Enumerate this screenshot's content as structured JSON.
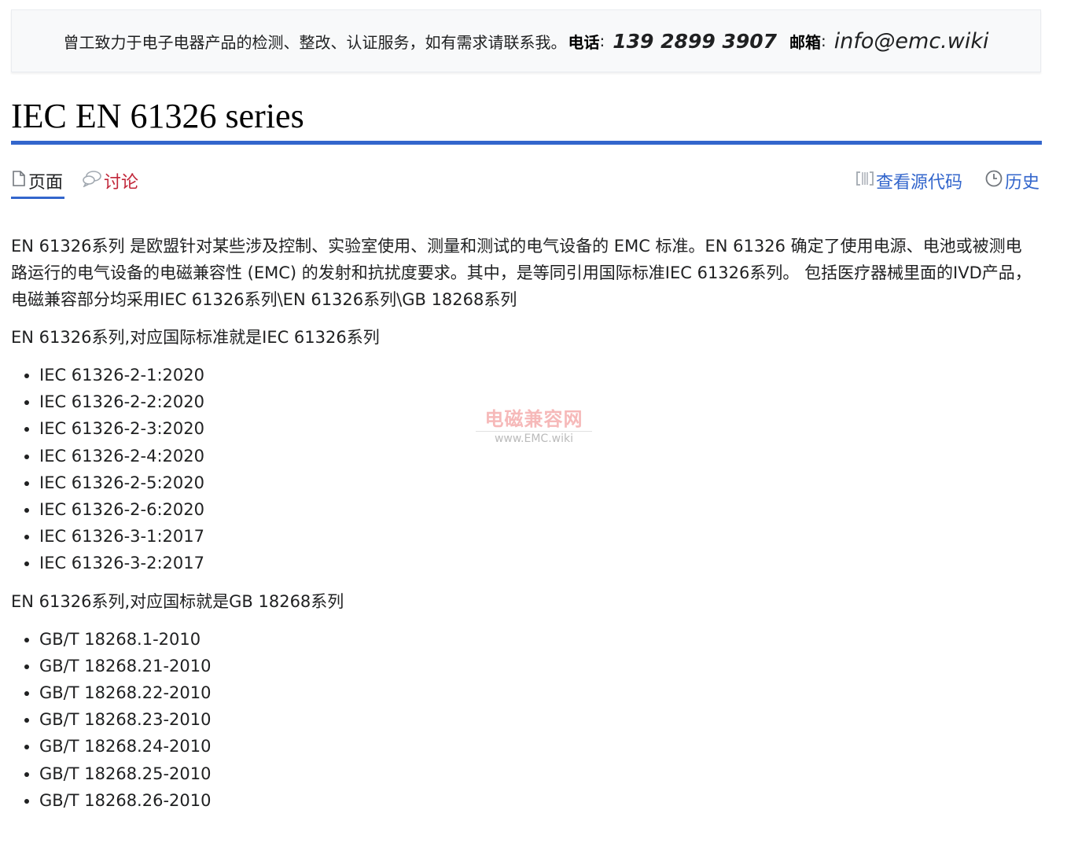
{
  "banner": {
    "intro": "曾工致力于电子电器产品的检测、整改、认证服务，如有需求请联系我。",
    "phone_label": "电话",
    "phone": "139 2899 3907",
    "email_label": "邮箱",
    "email": "info@emc.wiki"
  },
  "page_title": "IEC EN 61326 series",
  "tabs": {
    "page": "页面",
    "talk": "讨论",
    "view_source": "查看源代码",
    "history": "历史"
  },
  "content": {
    "intro": "EN 61326系列 是欧盟针对某些涉及控制、实验室使用、测量和测试的电气设备的 EMC 标准。EN 61326 确定了使用电源、电池或被测电路运行的电气设备的电磁兼容性 (EMC) 的发射和抗扰度要求。其中，是等同引用国际标准IEC 61326系列。 包括医疗器械里面的IVD产品，电磁兼容部分均采用IEC 61326系列\\EN 61326系列\\GB 18268系列",
    "iec_heading": "EN 61326系列,对应国际标准就是IEC 61326系列",
    "iec_list": [
      "IEC 61326-2-1:2020",
      "IEC 61326-2-2:2020",
      "IEC 61326-2-3:2020",
      "IEC 61326-2-4:2020",
      "IEC 61326-2-5:2020",
      "IEC 61326-2-6:2020",
      "IEC 61326-3-1:2017",
      "IEC 61326-3-2:2017"
    ],
    "gb_heading": "EN 61326系列,对应国标就是GB 18268系列",
    "gb_list": [
      "GB/T 18268.1-2010",
      "GB/T 18268.21-2010",
      "GB/T 18268.22-2010",
      "GB/T 18268.23-2010",
      "GB/T 18268.24-2010",
      "GB/T 18268.25-2010",
      "GB/T 18268.26-2010"
    ]
  },
  "watermark": {
    "line1": "电磁兼容网",
    "line2": "www.EMC.wiki"
  },
  "colors": {
    "accent": "#3366cc",
    "talk_link": "#c1273a",
    "banner_bg": "#f8f9fa"
  }
}
